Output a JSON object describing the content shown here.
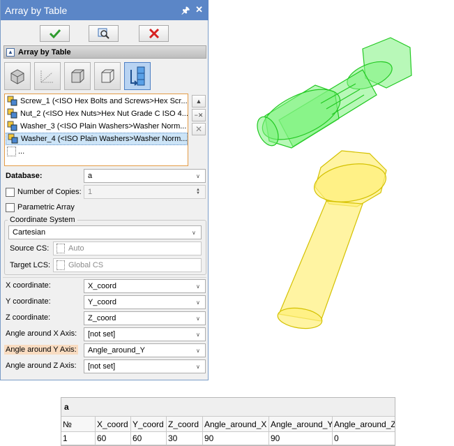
{
  "panel": {
    "title": "Array by Table",
    "section_title": "Array by Table",
    "objects": [
      {
        "label": "Screw_1 (<ISO Hex Bolts and Screws>Hex Scr..."
      },
      {
        "label": "Nut_2 (<ISO Hex Nuts>Hex Nut Grade C ISO 4..."
      },
      {
        "label": "Washer_3 (<ISO Plain Washers>Washer Norm..."
      },
      {
        "label": "Washer_4 (<ISO Plain Washers>Washer Norm..."
      },
      {
        "label": "..."
      }
    ],
    "database": {
      "label": "Database:",
      "value": "a"
    },
    "copies": {
      "label": "Number of Copies:",
      "value": "1"
    },
    "parametric": {
      "label": "Parametric Array"
    },
    "coord_system": {
      "group_label": "Coordinate System",
      "type": "Cartesian",
      "source_label": "Source CS:",
      "source_value": "Auto",
      "target_label": "Target LCS:",
      "target_value": "Global CS"
    },
    "coords": [
      {
        "label": "X coordinate:",
        "value": "X_coord"
      },
      {
        "label": "Y coordinate:",
        "value": "Y_coord"
      },
      {
        "label": "Z coordinate:",
        "value": "Z_coord"
      },
      {
        "label": "Angle around X Axis:",
        "value": "[not set]"
      },
      {
        "label": "Angle around Y Axis:",
        "value": "Angle_around_Y"
      },
      {
        "label": "Angle around Z Axis:",
        "value": "[not set]"
      }
    ]
  },
  "table": {
    "title": "a",
    "headers": [
      "№",
      "X_coord",
      "Y_coord",
      "Z_coord",
      "Angle_around_X",
      "Angle_around_Y",
      "Angle_around_Z"
    ],
    "rows": [
      [
        "1",
        "60",
        "60",
        "30",
        "90",
        "90",
        "0"
      ]
    ]
  },
  "colors": {
    "title_bar": "#5b86c7",
    "green_model": "#33e633",
    "yellow_model": "#ffea2e",
    "highlight": "#f9dcc1"
  },
  "icons": {
    "ok": "check-icon",
    "preview": "preview-icon",
    "cancel": "close-icon"
  }
}
